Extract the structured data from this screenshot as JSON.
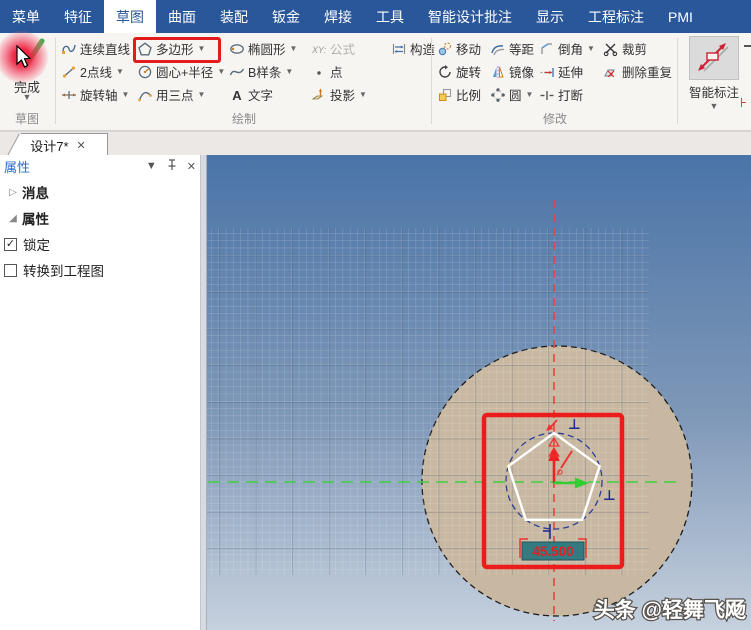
{
  "menu_bar": {
    "tabs": [
      "菜单",
      "特征",
      "草图",
      "曲面",
      "装配",
      "钣金",
      "焊接",
      "工具",
      "智能设计批注",
      "显示",
      "工程标注",
      "PMI"
    ],
    "active_tab": "草图"
  },
  "ribbon": {
    "finish": {
      "label": "完成",
      "group_label": "草图"
    },
    "draw": {
      "group_label": "绘制",
      "tools": [
        {
          "label": "连续直线"
        },
        {
          "label": "2点线",
          "dropdown": true
        },
        {
          "label": "旋转轴",
          "dropdown": true
        },
        {
          "label": "多边形",
          "dropdown": true,
          "highlighted": true
        },
        {
          "label": "圆心+半径",
          "dropdown": true
        },
        {
          "label": "用三点",
          "dropdown": true
        },
        {
          "label": "椭圆形",
          "dropdown": true
        },
        {
          "label": "B样条",
          "dropdown": true
        },
        {
          "label": "文字"
        },
        {
          "label": "公式",
          "disabled": true
        },
        {
          "label": "点"
        },
        {
          "label": "投影",
          "dropdown": true
        },
        {
          "label": "构造"
        }
      ]
    },
    "modify": {
      "group_label": "修改",
      "tools": [
        {
          "label": "移动"
        },
        {
          "label": "旋转"
        },
        {
          "label": "比例"
        },
        {
          "label": "等距"
        },
        {
          "label": "镜像"
        },
        {
          "label": "圆",
          "dropdown": true
        },
        {
          "label": "倒角",
          "dropdown": true
        },
        {
          "label": "延伸"
        },
        {
          "label": "打断"
        },
        {
          "label": "裁剪"
        },
        {
          "label": "删除重复"
        }
      ]
    },
    "smart_dimension": {
      "label": "智能标注"
    }
  },
  "document_tab": {
    "label": "设计7*",
    "close_glyph": "✕"
  },
  "panel": {
    "title": "属性",
    "sections": [
      {
        "label": "消息",
        "state": "collapsed"
      },
      {
        "label": "属性",
        "state": "expanded"
      }
    ],
    "checkboxes": [
      {
        "label": "锁定",
        "checked": true,
        "glyph": "✓"
      },
      {
        "label": "转换到工程图",
        "checked": false,
        "glyph": ""
      }
    ]
  },
  "canvas": {
    "dimension_value": "45.500",
    "watermark": "头条 @轻舞飞飏",
    "colors": {
      "highlight_red": "#e21c1c",
      "dimension_box": "#357a80",
      "dimension_text": "#e02020",
      "sketch_surface": "#c8b8a1",
      "axis_x_green": "#33cc33",
      "axis_y_red": "#ee2222",
      "constraint_navy": "#1f2e8c"
    }
  }
}
